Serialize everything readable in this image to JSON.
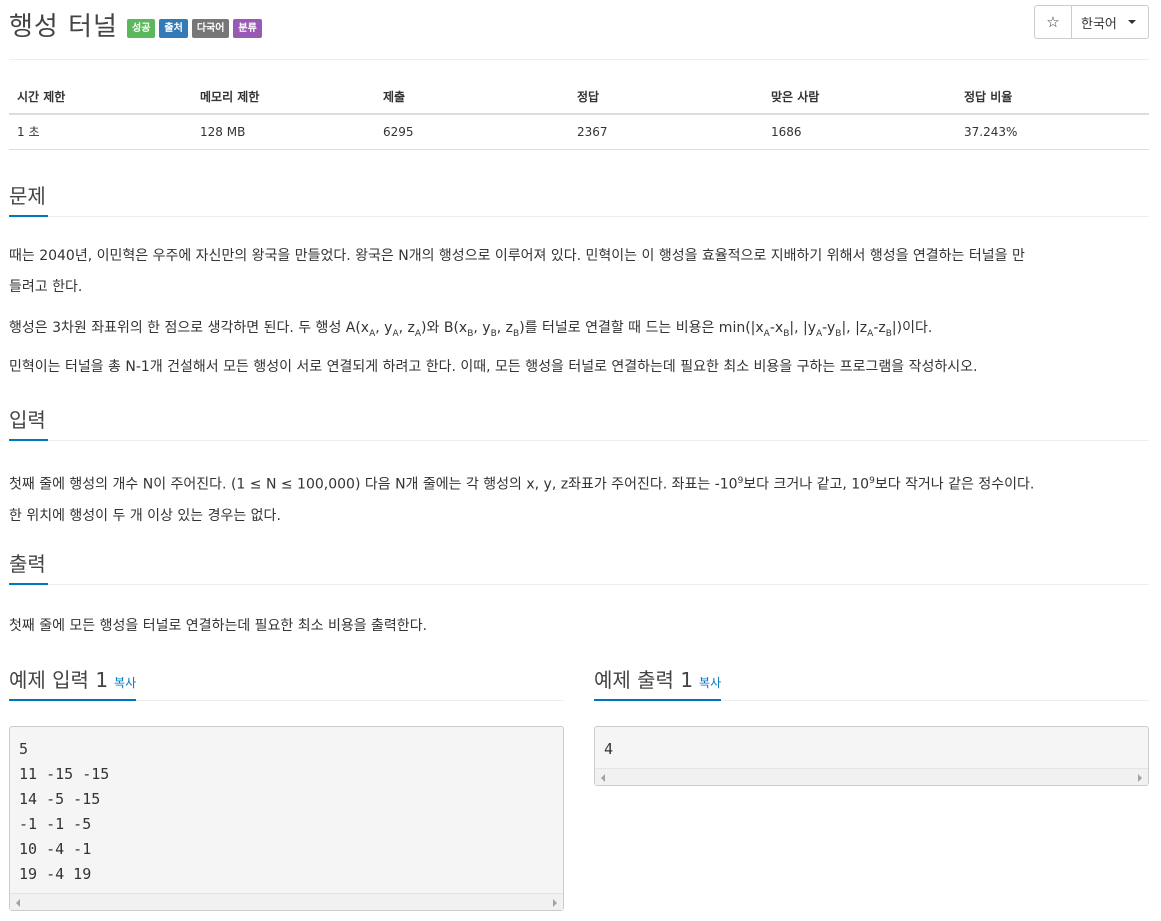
{
  "header": {
    "title": "행성 터널",
    "labels": [
      {
        "text": "성공",
        "color": "#5cb85c"
      },
      {
        "text": "출처",
        "color": "#337ab7"
      },
      {
        "text": "다국어",
        "color": "#777777"
      },
      {
        "text": "분류",
        "color": "#9b59b6"
      }
    ],
    "star_icon": "☆",
    "language": "한국어"
  },
  "stats": {
    "headers": [
      "시간 제한",
      "메모리 제한",
      "제출",
      "정답",
      "맞은 사람",
      "정답 비율"
    ],
    "values": [
      "1 초",
      "128 MB",
      "6295",
      "2367",
      "1686",
      "37.243%"
    ]
  },
  "problem": {
    "heading": "문제",
    "p1_line1": "때는 2040년, 이민혁은 우주에 자신만의 왕국을 만들었다. 왕국은 N개의 행성으로 이루어져 있다. 민혁이는 이 행성을 효율적으로 지배하기 위해서 행성을 연결하는 터널을 만",
    "p1_line2": "들려고 한다.",
    "p2_prefix": "행성은 3차원 좌표위의 한 점으로 생각하면 된다. 두 행성 A(x",
    "p2_suffix": ")이다.",
    "p3": "민혁이는 터널을 총 N-1개 건설해서 모든 행성이 서로 연결되게 하려고 한다. 이때, 모든 행성을 터널로 연결하는데 필요한 최소 비용을 구하는 프로그램을 작성하시오."
  },
  "input": {
    "heading": "입력",
    "line1_a": "첫째 줄에 행성의 개수 N이 주어진다. (1 ≤ N ≤ 100,000) 다음 N개 줄에는 각 행성의 x, y, z좌표가 주어진다. 좌표는 -10",
    "exp": "9",
    "line1_b": "보다 크거나 같고, 10",
    "line1_c": "보다 작거나 같은 정수이다.",
    "line2": "한 위치에 행성이 두 개 이상 있는 경우는 없다."
  },
  "output": {
    "heading": "출력",
    "text": "첫째 줄에 모든 행성을 터널로 연결하는데 필요한 최소 비용을 출력한다."
  },
  "sample_input": {
    "heading": "예제 입력 1",
    "copy": "복사",
    "lines": [
      "5",
      "11 -15 -15",
      "14 -5 -15",
      "-1 -1 -5",
      "10 -4 -1",
      "19 -4 19"
    ]
  },
  "sample_output": {
    "heading": "예제 출력 1",
    "copy": "복사",
    "lines": [
      "4"
    ]
  }
}
